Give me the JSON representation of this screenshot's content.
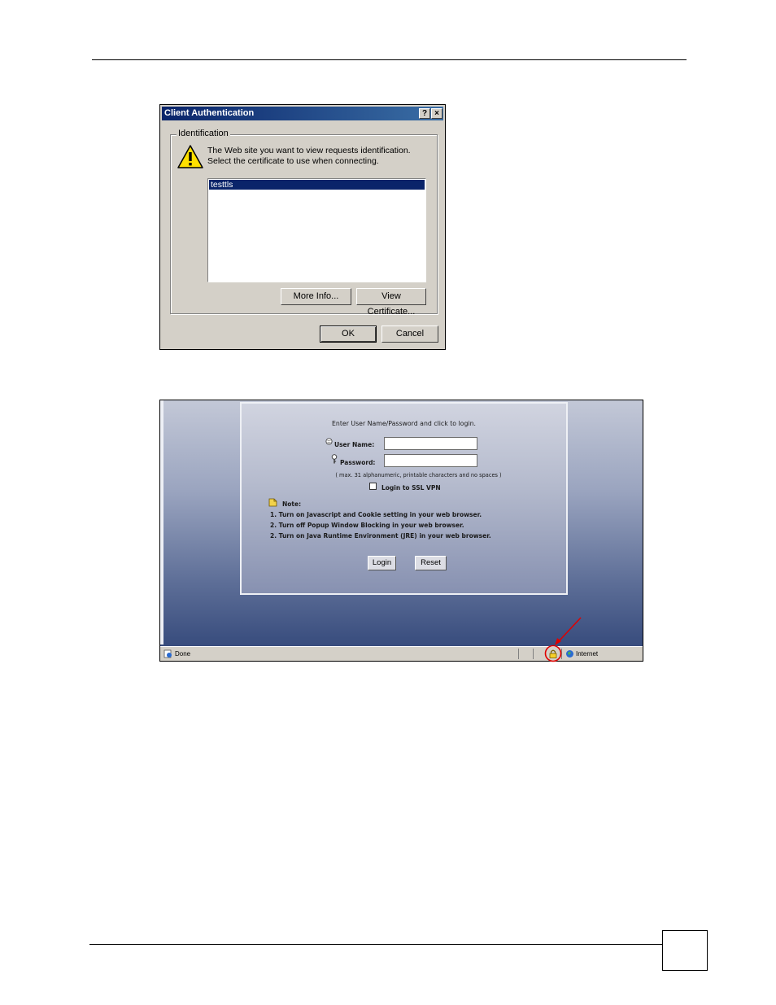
{
  "dialog": {
    "title": "Client Authentication",
    "help_label": "?",
    "close_label": "×",
    "group_label": "Identification",
    "message_line1": "The Web site you want to view requests identification.",
    "message_line2": "Select the certificate to use when connecting.",
    "certificates": [
      "testtls"
    ],
    "more_info_label": "More Info...",
    "view_certificate_label": "View Certificate...",
    "ok_label": "OK",
    "cancel_label": "Cancel"
  },
  "login": {
    "prompt": "Enter User Name/Password and click to login.",
    "username_label": "User Name:",
    "password_label": "Password:",
    "hint": "( max. 31 alphanumeric, printable characters and no spaces )",
    "ssl_vpn_label": "Login to SSL VPN",
    "note_label": "Note:",
    "notes": [
      {
        "pre": "1. Turn on ",
        "bold": "Javascript and Cookie",
        "post": " setting in your web browser."
      },
      {
        "pre": "2. Turn off ",
        "bold": "Popup Window",
        "post": " Blocking in your web browser."
      },
      {
        "pre": "2. Turn on ",
        "bold": "Java Runtime Environment (JRE)",
        "post": " in your web browser."
      }
    ],
    "login_button": "Login",
    "reset_button": "Reset"
  },
  "statusbar": {
    "status_text": "Done",
    "zone_text": "Internet"
  },
  "colors": {
    "title_bar": "#0a246a",
    "selection": "#0a246a",
    "annotation": "#e00000"
  }
}
